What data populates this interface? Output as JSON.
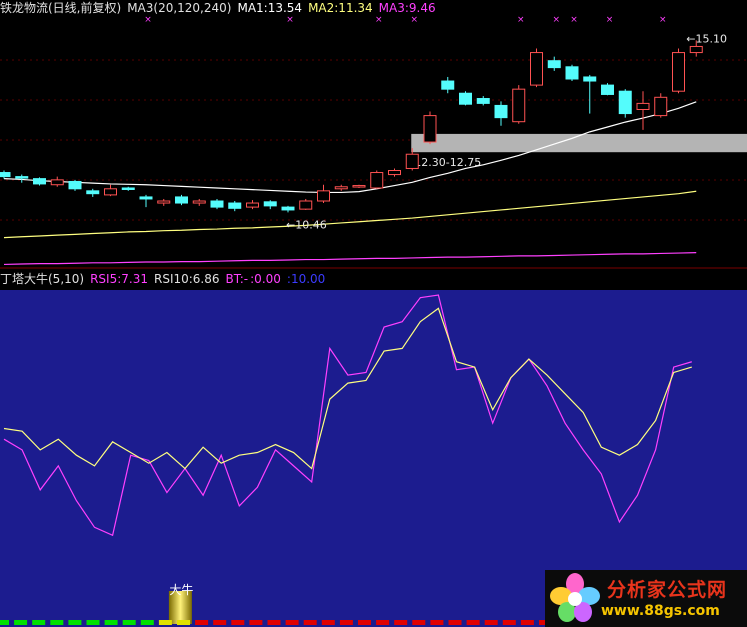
{
  "header_top": {
    "name": "铁龙物流(日线,前复权)",
    "ma3_params": "MA3(20,120,240)",
    "ma1": "MA1:13.54",
    "ma2": "MA2:11.34",
    "ma3": "MA3:9.46"
  },
  "header_bottom": {
    "name": "丁塔大牛(5,10)",
    "rsi5": "RSI5:7.31",
    "rsi10": "RSI10:6.86",
    "bt": "BT:-",
    "v1": ":0.00",
    "v2": ":10.00"
  },
  "colors": {
    "up": "#ff5252",
    "down": "#54fcfc",
    "ma1": "#ffffff",
    "ma2": "#ffff80",
    "ma3": "#ff40ff",
    "rsi5": "#ff40ff",
    "rsi10": "#ffff80",
    "panel_bg": "#1c1c8f",
    "zone_fill": "#b4b4b4",
    "signal": "#e6e600"
  },
  "chart_data": [
    {
      "type": "candlestick",
      "ylim": [
        9.6,
        15.6
      ],
      "candles": [
        {
          "o": 11.8,
          "h": 11.85,
          "l": 11.65,
          "c": 11.7
        },
        {
          "o": 11.7,
          "h": 11.75,
          "l": 11.55,
          "c": 11.68
        },
        {
          "o": 11.65,
          "h": 11.68,
          "l": 11.48,
          "c": 11.52
        },
        {
          "o": 11.5,
          "h": 11.7,
          "l": 11.45,
          "c": 11.62
        },
        {
          "o": 11.58,
          "h": 11.62,
          "l": 11.35,
          "c": 11.4
        },
        {
          "o": 11.35,
          "h": 11.4,
          "l": 11.2,
          "c": 11.28
        },
        {
          "o": 11.25,
          "h": 11.5,
          "l": 11.22,
          "c": 11.4
        },
        {
          "o": 11.42,
          "h": 11.45,
          "l": 11.35,
          "c": 11.4
        },
        {
          "o": 11.2,
          "h": 11.25,
          "l": 10.95,
          "c": 11.15
        },
        {
          "o": 11.05,
          "h": 11.15,
          "l": 10.98,
          "c": 11.1
        },
        {
          "o": 11.2,
          "h": 11.25,
          "l": 11.0,
          "c": 11.05
        },
        {
          "o": 11.05,
          "h": 11.15,
          "l": 10.98,
          "c": 11.1
        },
        {
          "o": 11.1,
          "h": 11.15,
          "l": 10.9,
          "c": 10.95
        },
        {
          "o": 11.05,
          "h": 11.1,
          "l": 10.85,
          "c": 10.92
        },
        {
          "o": 10.95,
          "h": 11.12,
          "l": 10.9,
          "c": 11.05
        },
        {
          "o": 11.08,
          "h": 11.12,
          "l": 10.9,
          "c": 10.98
        },
        {
          "o": 10.95,
          "h": 10.98,
          "l": 10.82,
          "c": 10.88
        },
        {
          "o": 10.9,
          "h": 11.15,
          "l": 10.88,
          "c": 11.1
        },
        {
          "o": 11.1,
          "h": 11.5,
          "l": 11.05,
          "c": 11.35
        },
        {
          "o": 11.4,
          "h": 11.5,
          "l": 11.35,
          "c": 11.45
        },
        {
          "o": 11.45,
          "h": 11.5,
          "l": 11.42,
          "c": 11.48
        },
        {
          "o": 11.42,
          "h": 11.85,
          "l": 11.4,
          "c": 11.8
        },
        {
          "o": 11.75,
          "h": 11.9,
          "l": 11.7,
          "c": 11.85
        },
        {
          "o": 11.9,
          "h": 12.4,
          "l": 11.85,
          "c": 12.25
        },
        {
          "o": 12.55,
          "h": 13.3,
          "l": 12.5,
          "c": 13.2
        },
        {
          "o": 14.05,
          "h": 14.15,
          "l": 13.75,
          "c": 13.85
        },
        {
          "o": 13.75,
          "h": 13.8,
          "l": 13.45,
          "c": 13.48
        },
        {
          "o": 13.62,
          "h": 13.68,
          "l": 13.45,
          "c": 13.5
        },
        {
          "o": 13.45,
          "h": 13.55,
          "l": 12.95,
          "c": 13.15
        },
        {
          "o": 13.05,
          "h": 13.95,
          "l": 13.0,
          "c": 13.85
        },
        {
          "o": 13.95,
          "h": 14.85,
          "l": 13.9,
          "c": 14.75
        },
        {
          "o": 14.55,
          "h": 14.65,
          "l": 14.3,
          "c": 14.38
        },
        {
          "o": 14.4,
          "h": 14.45,
          "l": 14.05,
          "c": 14.1
        },
        {
          "o": 14.15,
          "h": 14.2,
          "l": 13.25,
          "c": 14.05
        },
        {
          "o": 13.95,
          "h": 14.0,
          "l": 13.7,
          "c": 13.72
        },
        {
          "o": 13.8,
          "h": 13.85,
          "l": 13.15,
          "c": 13.25
        },
        {
          "o": 13.35,
          "h": 13.8,
          "l": 12.85,
          "c": 13.5
        },
        {
          "o": 13.2,
          "h": 13.75,
          "l": 13.15,
          "c": 13.65
        },
        {
          "o": 13.8,
          "h": 14.85,
          "l": 13.75,
          "c": 14.75
        },
        {
          "o": 14.75,
          "h": 15.05,
          "l": 14.65,
          "c": 14.9
        }
      ],
      "ma1": [
        11.65,
        11.63,
        11.6,
        11.58,
        11.56,
        11.54,
        11.52,
        11.51,
        11.5,
        11.48,
        11.46,
        11.44,
        11.42,
        11.4,
        11.38,
        11.36,
        11.34,
        11.32,
        11.31,
        11.31,
        11.33,
        11.4,
        11.48,
        11.56,
        11.68,
        11.78,
        11.9,
        11.99,
        12.1,
        12.22,
        12.36,
        12.5,
        12.64,
        12.8,
        12.92,
        13.04,
        13.14,
        13.25,
        13.38,
        13.54
      ],
      "ma2": [
        10.2,
        10.22,
        10.24,
        10.26,
        10.28,
        10.3,
        10.32,
        10.34,
        10.35,
        10.37,
        10.38,
        10.4,
        10.41,
        10.43,
        10.44,
        10.46,
        10.48,
        10.5,
        10.53,
        10.56,
        10.59,
        10.62,
        10.65,
        10.68,
        10.72,
        10.76,
        10.8,
        10.84,
        10.88,
        10.92,
        10.96,
        11.0,
        11.04,
        11.08,
        11.12,
        11.16,
        11.2,
        11.24,
        11.28,
        11.34
      ],
      "ma3": [
        9.54,
        9.55,
        9.56,
        9.56,
        9.57,
        9.58,
        9.58,
        9.59,
        9.6,
        9.6,
        9.61,
        9.61,
        9.62,
        9.63,
        9.64,
        9.64,
        9.65,
        9.66,
        9.66,
        9.67,
        9.68,
        9.69,
        9.69,
        9.7,
        9.71,
        9.72,
        9.72,
        9.73,
        9.74,
        9.75,
        9.75,
        9.76,
        9.77,
        9.78,
        9.79,
        9.8,
        9.8,
        9.81,
        9.82,
        9.83
      ],
      "annotations": {
        "low_label": "10.46",
        "high_label": "15.10",
        "zone_label": "12.30-12.75",
        "zone_range": [
          12.3,
          12.75
        ],
        "zone_start_index": 23
      },
      "marker_indices": [
        8,
        16,
        21,
        23,
        29,
        31,
        32,
        34,
        37
      ]
    },
    {
      "type": "line",
      "ylim": [
        0,
        100
      ],
      "series": [
        {
          "name": "RSI5",
          "values": [
            46,
            42,
            27,
            36,
            23,
            13,
            10,
            40,
            38,
            26,
            35,
            25,
            40,
            21,
            28,
            42,
            36,
            30,
            80,
            70,
            71,
            88,
            90,
            99,
            100,
            72,
            73,
            52,
            69,
            76,
            66,
            52,
            42,
            33,
            15,
            25,
            42,
            73,
            75
          ]
        },
        {
          "name": "RSI10",
          "values": [
            50,
            49,
            42,
            46,
            40,
            36,
            45,
            41,
            37,
            41,
            35,
            43,
            37,
            40,
            41,
            44,
            41,
            35,
            61,
            67,
            68,
            79,
            80,
            90,
            95,
            75,
            73,
            57,
            69,
            76,
            70,
            63,
            56,
            43,
            40,
            44,
            53,
            71,
            73
          ]
        }
      ],
      "signal_label": "大牛",
      "signal_index": 9,
      "tick_colors": [
        "green",
        "green",
        "green",
        "green",
        "green",
        "green",
        "green",
        "green",
        "green",
        "yellow",
        "yellow",
        "red",
        "red",
        "red",
        "red",
        "red",
        "red",
        "red",
        "red",
        "red",
        "red",
        "red",
        "red",
        "red",
        "red",
        "red",
        "red",
        "red",
        "red",
        "red",
        "red",
        "red",
        "red",
        "red",
        "red",
        "red",
        "red",
        "red",
        "red"
      ]
    }
  ],
  "logo": {
    "title": "分析家公式网",
    "url": "www.88gs.com"
  }
}
